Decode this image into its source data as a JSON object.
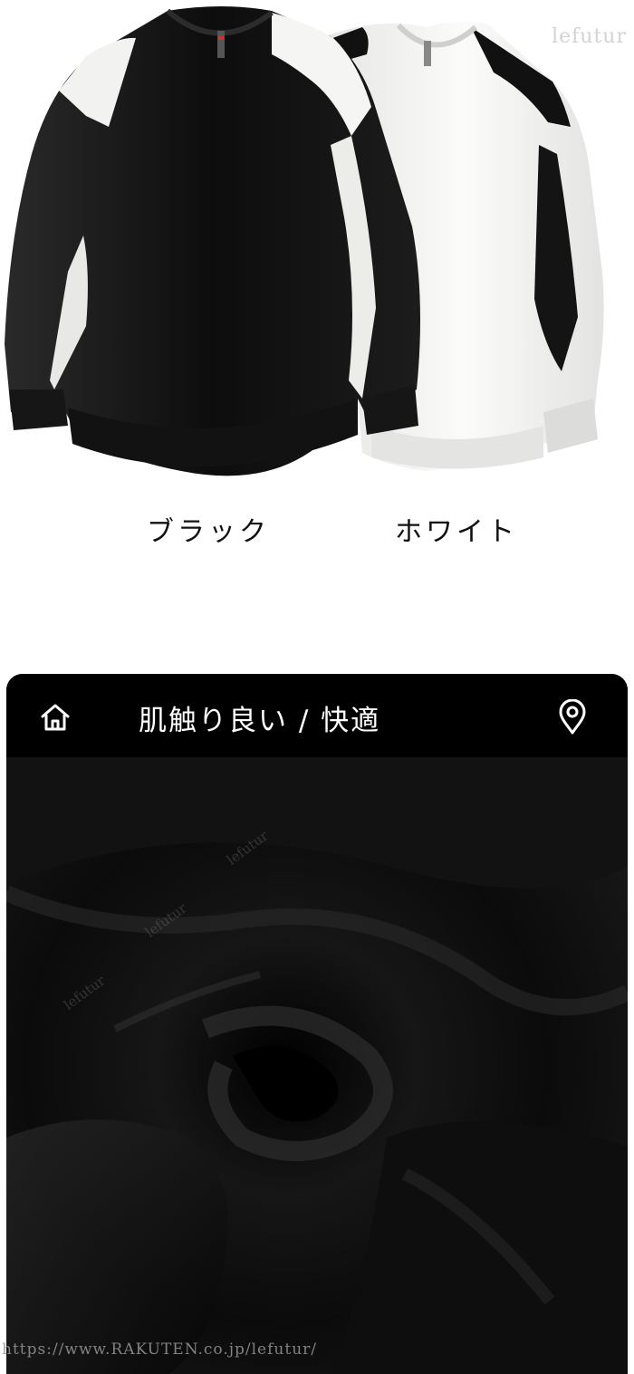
{
  "products": {
    "black_label": "ブラック",
    "white_label": "ホワイト"
  },
  "watermark": {
    "brand": "lefutur",
    "url": "https://www.RAKUTEN.co.jp/lefutur/"
  },
  "panel": {
    "title": "肌触り良い / 快適",
    "icons": [
      "home-icon",
      "location-pin-icon"
    ]
  },
  "colors": {
    "panel_bg": "#050505",
    "text_white": "#ffffff"
  }
}
